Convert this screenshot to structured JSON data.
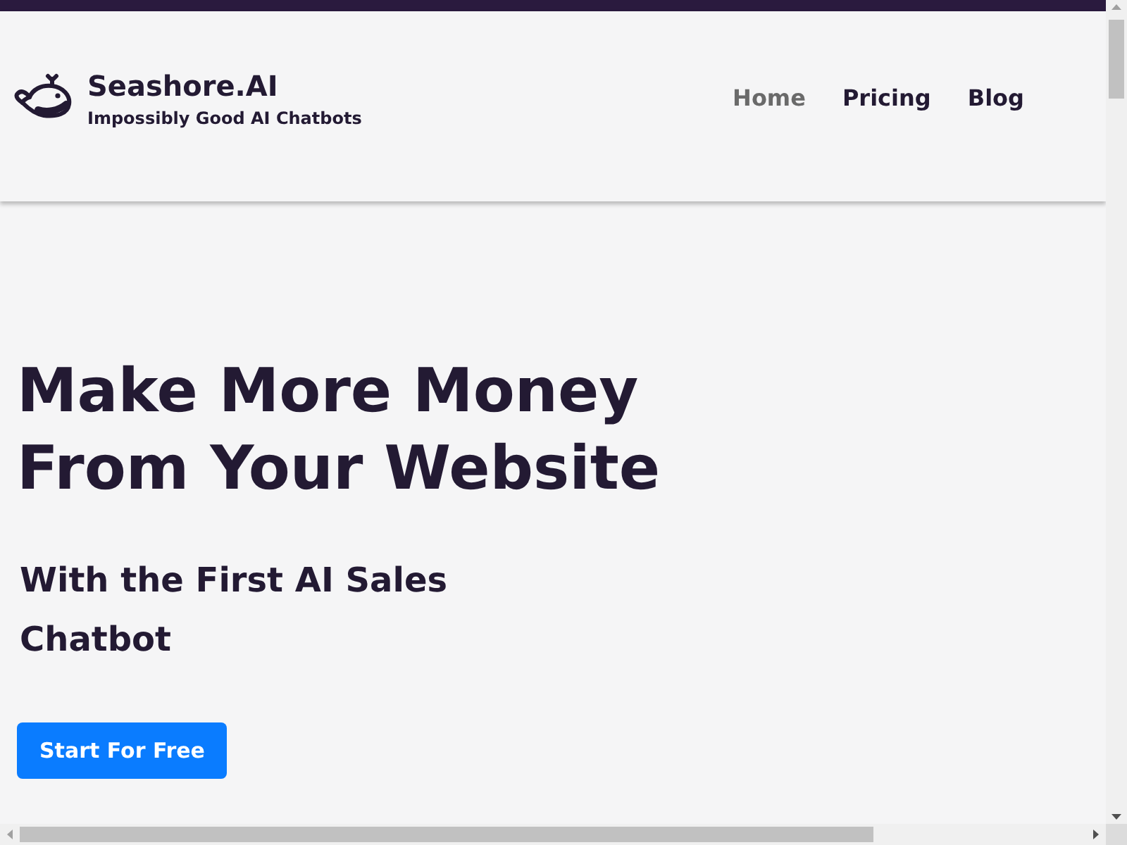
{
  "brand": {
    "name": "Seashore.AI",
    "tagline": "Impossibly Good AI Chatbots"
  },
  "nav": [
    {
      "label": "Home",
      "selected": true
    },
    {
      "label": "Pricing",
      "selected": false
    },
    {
      "label": "Blog",
      "selected": false
    }
  ],
  "hero": {
    "headline": [
      "Make More Money",
      "From Your Website"
    ],
    "subheadline": [
      "With the First AI Sales",
      "Chatbot"
    ],
    "cta": "Start For Free"
  }
}
